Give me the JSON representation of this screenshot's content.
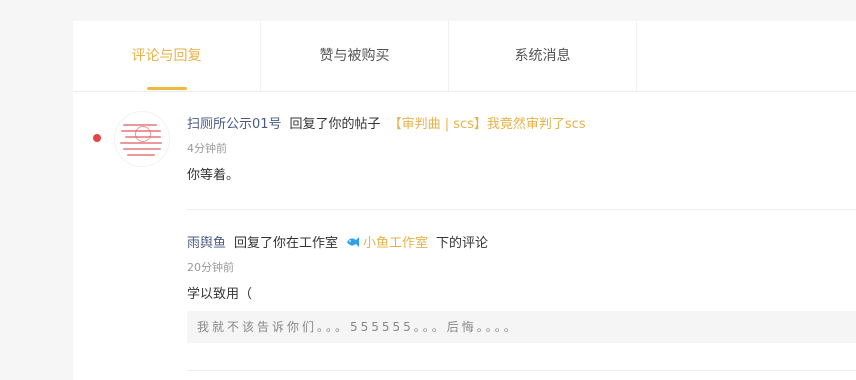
{
  "tabs": [
    {
      "label": "评论与回复",
      "active": true
    },
    {
      "label": "赞与被购买",
      "active": false
    },
    {
      "label": "系统消息",
      "active": false
    }
  ],
  "messages": [
    {
      "user": "扫厕所公示01号",
      "action": "回复了你的帖子",
      "target": "【审判曲 | scs】我竟然审判了scs",
      "time": "4分钟前",
      "content": "你等着。",
      "unread": true,
      "avatar_icon": "avatar-image-icon"
    },
    {
      "user": "雨舆鱼",
      "action": "回复了你在工作室",
      "studio_icon": "fish-icon",
      "studio": "小鱼工作室",
      "action_suffix": "下的评论",
      "time": "20分钟前",
      "content": "学以致用（",
      "quote": "我就不该告诉你们。。。555555。。。后悔。。。。"
    }
  ],
  "colors": {
    "accent": "#e8b24a",
    "username": "#4a5a86",
    "unread_dot": "#e64444",
    "fish": "#2fa3e6"
  }
}
